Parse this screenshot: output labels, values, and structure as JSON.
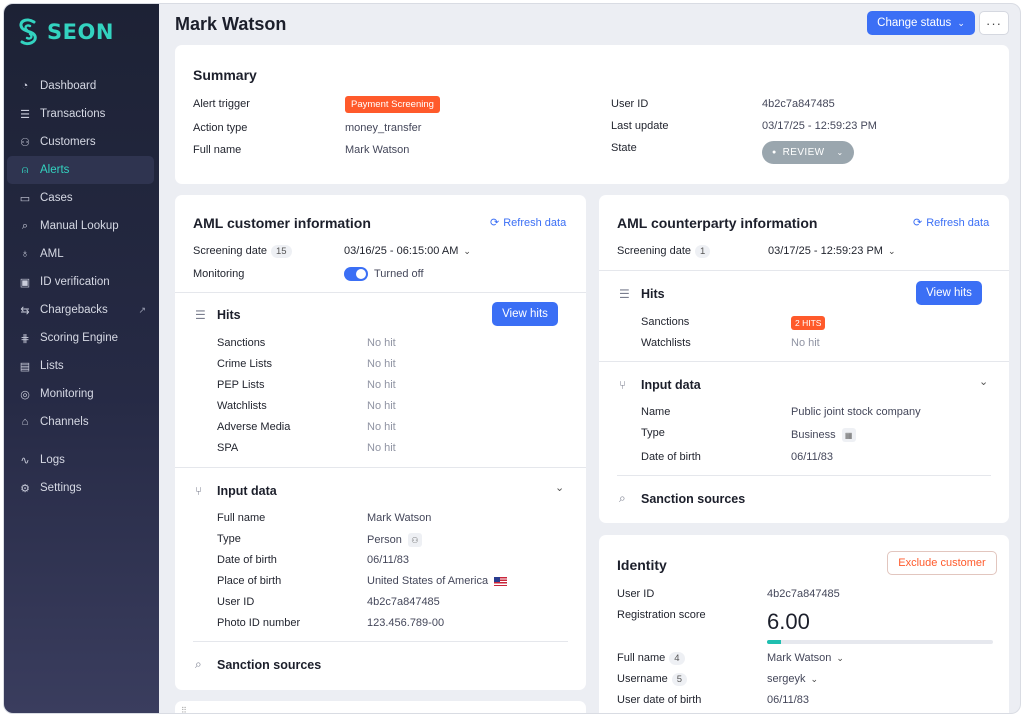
{
  "brand": {
    "name": "SEON"
  },
  "sidebar": {
    "items": [
      {
        "label": "Dashboard",
        "icon": "gauge-icon"
      },
      {
        "label": "Transactions",
        "icon": "list-icon"
      },
      {
        "label": "Customers",
        "icon": "users-icon"
      },
      {
        "label": "Alerts",
        "icon": "bell-icon",
        "active": true
      },
      {
        "label": "Cases",
        "icon": "folder-icon"
      },
      {
        "label": "Manual Lookup",
        "icon": "search-icon"
      },
      {
        "label": "AML",
        "icon": "money-bag-icon"
      },
      {
        "label": "ID verification",
        "icon": "id-card-icon"
      },
      {
        "label": "Chargebacks",
        "icon": "chargeback-icon",
        "external": true
      },
      {
        "label": "Scoring Engine",
        "icon": "sliders-icon"
      },
      {
        "label": "Lists",
        "icon": "list-doc-icon"
      },
      {
        "label": "Monitoring",
        "icon": "radar-icon"
      },
      {
        "label": "Channels",
        "icon": "store-icon"
      },
      {
        "label": "Logs",
        "icon": "pulse-icon"
      },
      {
        "label": "Settings",
        "icon": "gear-icon"
      }
    ]
  },
  "header": {
    "title": "Mark Watson",
    "change_status": "Change status",
    "more": "···"
  },
  "summary": {
    "title": "Summary",
    "alert_trigger_label": "Alert trigger",
    "alert_trigger_value": "Payment Screening",
    "action_type_label": "Action type",
    "action_type_value": "money_transfer",
    "full_name_label": "Full name",
    "full_name_value": "Mark Watson",
    "user_id_label": "User ID",
    "user_id_value": "4b2c7a847485",
    "last_update_label": "Last update",
    "last_update_value": "03/17/25 - 12:59:23 PM",
    "state_label": "State",
    "state_value": "REVIEW"
  },
  "aml_customer": {
    "title": "AML customer information",
    "refresh": "Refresh data",
    "screening_date_label": "Screening date",
    "screening_count": "15",
    "screening_date_value": "03/16/25 - 06:15:00 AM",
    "monitoring_label": "Monitoring",
    "monitoring_value": "Turned off",
    "hits_title": "Hits",
    "view_hits": "View hits",
    "hits": [
      {
        "label": "Sanctions",
        "value": "No hit"
      },
      {
        "label": "Crime Lists",
        "value": "No hit"
      },
      {
        "label": "PEP Lists",
        "value": "No hit"
      },
      {
        "label": "Watchlists",
        "value": "No hit"
      },
      {
        "label": "Adverse Media",
        "value": "No hit"
      },
      {
        "label": "SPA",
        "value": "No hit"
      }
    ],
    "input_title": "Input data",
    "input": [
      {
        "label": "Full name",
        "value": "Mark Watson"
      },
      {
        "label": "Type",
        "value": "Person"
      },
      {
        "label": "Date of birth",
        "value": "06/11/83"
      },
      {
        "label": "Place of birth",
        "value": "United States of America"
      },
      {
        "label": "User ID",
        "value": "4b2c7a847485"
      },
      {
        "label": "Photo ID number",
        "value": "123.456.789-00"
      }
    ],
    "sanction_sources": "Sanction sources"
  },
  "aml_counterparty": {
    "title": "AML counterparty information",
    "refresh": "Refresh data",
    "screening_date_label": "Screening date",
    "screening_count": "1",
    "screening_date_value": "03/17/25 - 12:59:23 PM",
    "hits_title": "Hits",
    "view_hits": "View hits",
    "hits": [
      {
        "label": "Sanctions",
        "value": "2 HITS"
      },
      {
        "label": "Watchlists",
        "value": "No hit"
      }
    ],
    "input_title": "Input data",
    "input": [
      {
        "label": "Name",
        "value": "Public joint stock company"
      },
      {
        "label": "Type",
        "value": "Business"
      },
      {
        "label": "Date of birth",
        "value": "06/11/83"
      }
    ],
    "sanction_sources": "Sanction sources"
  },
  "identity": {
    "title": "Identity",
    "exclude": "Exclude customer",
    "user_id_label": "User ID",
    "user_id_value": "4b2c7a847485",
    "reg_score_label": "Registration score",
    "reg_score_value": "6.00",
    "reg_score_fraction": 0.06,
    "full_name_label": "Full name",
    "full_name_count": "4",
    "full_name_value": "Mark Watson",
    "username_label": "Username",
    "username_count": "5",
    "username_value": "sergeyk",
    "dob_label": "User date of birth",
    "dob_value": "06/11/83"
  },
  "colors": {
    "accent": "#3b6ff5",
    "brand": "#33d3c0",
    "danger": "#ff5a2b"
  }
}
